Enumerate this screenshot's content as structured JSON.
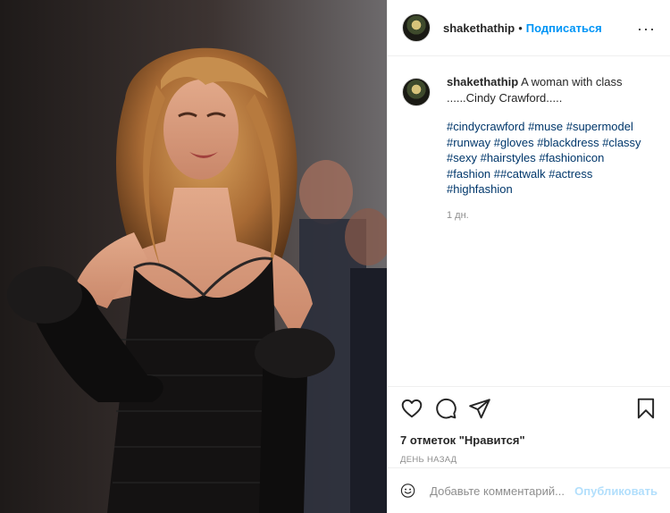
{
  "photo": {
    "alt_subject": "photo"
  },
  "header": {
    "username": "shakethathip",
    "separator": "•",
    "follow_label": "Подписаться",
    "more_icon": "more-horizontal-icon",
    "more_label": "···"
  },
  "caption": {
    "username": "shakethathip",
    "text_line1": "A woman with class",
    "text_line2": "......Cindy Crawford.....",
    "hashtags": [
      "#cindycrawford",
      "#muse",
      "#supermodel",
      "#runway",
      "#gloves",
      "#blackdress",
      "#classy",
      "#sexy",
      "#hairstyles",
      "#fashionicon",
      "#fashion",
      "##catwalk",
      "#actress",
      "#highfashion"
    ],
    "age": "1 дн."
  },
  "actions": {
    "like_icon": "heart-icon",
    "comment_icon": "comment-icon",
    "share_icon": "share-icon",
    "save_icon": "bookmark-icon",
    "likes_text": "7 отметок \"Нравится\"",
    "timestamp": "ДЕНЬ НАЗАД"
  },
  "comment": {
    "emoji_icon": "smile-icon",
    "placeholder": "Добавьте комментарий...",
    "publish_label": "Опубликовать"
  },
  "colors": {
    "link_blue": "#0095f6",
    "hashtag": "#00376b",
    "muted": "#8e8e8e",
    "publish_disabled": "#b2dffc"
  }
}
